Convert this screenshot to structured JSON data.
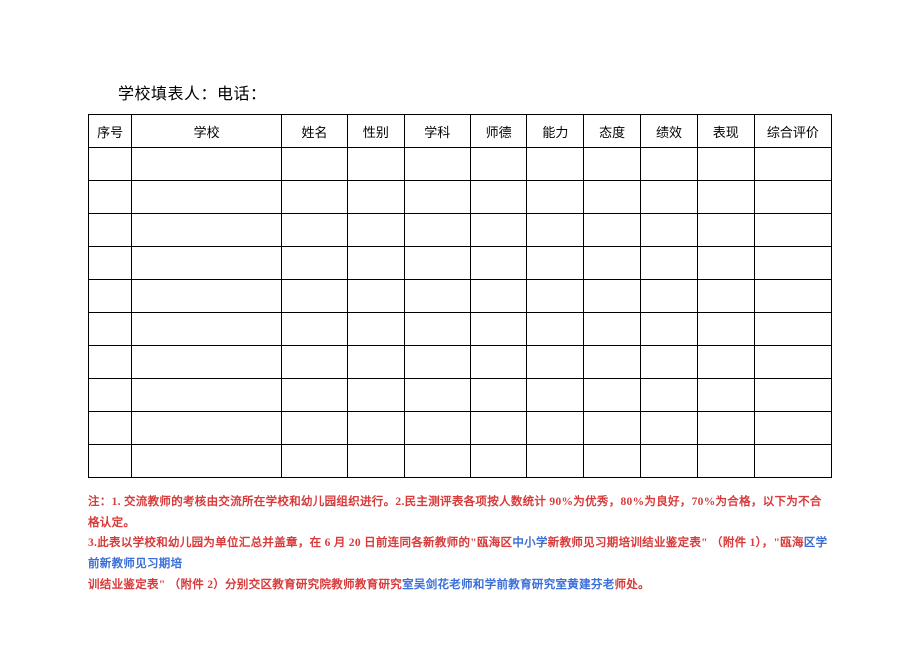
{
  "header": {
    "filler_label": "学校填表人：",
    "phone_label": "电话："
  },
  "table": {
    "columns": [
      "序号",
      "学校",
      "姓名",
      "性别",
      "学科",
      "师德",
      "能力",
      "态度",
      "绩效",
      "表现",
      "综合评价"
    ],
    "row_count": 10
  },
  "notes": {
    "p1a": "注：1. 交流教师的考核由交流所在学校和幼儿园组织进行。2.民主测评表各项按人数统计 90%为优秀，80%为良好，70%为合格，以下为不合格认定。",
    "p2a": "3.此表以学校和幼儿园为单位汇总并盖章，在 6 月 20 日前连同各新教师的\"瓯海区",
    "p2b": "中小学",
    "p2c": "新教师见习期培训结业鉴定表\"  （附件 1），\"瓯海",
    "p2d": "区学前新教师见习期培",
    "p3a": "训结业鉴定表\"  （附件 2）分别交区教育研究院教师教育研究",
    "p3b": "室吴剑花老师和学前教育研究室黄建芬老",
    "p3c": "师处。"
  }
}
